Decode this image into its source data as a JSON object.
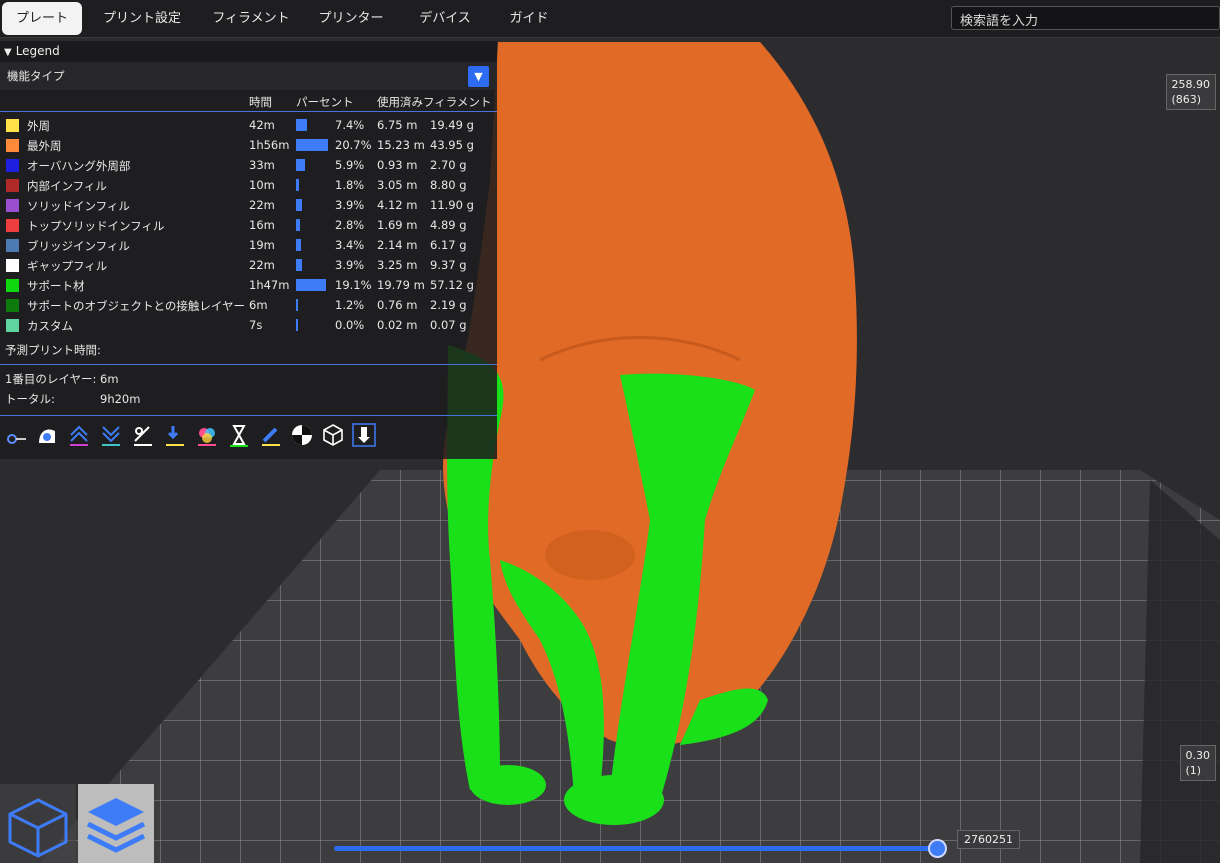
{
  "tabs": [
    {
      "label": "プレート"
    },
    {
      "label": "プリント設定"
    },
    {
      "label": "フィラメント"
    },
    {
      "label": "プリンター"
    },
    {
      "label": "デバイス"
    },
    {
      "label": "ガイド"
    }
  ],
  "search": {
    "placeholder": "検索語を入力"
  },
  "legend": {
    "title": "Legend",
    "feature_type_label": "機能タイプ",
    "columns": {
      "time": "時間",
      "percent": "パーセント",
      "filament": "使用済みフィラメント"
    },
    "rows": [
      {
        "color": "#ffe14a",
        "name": "外周",
        "time": "42m",
        "percent_value": 7.4,
        "percent": "7.4%",
        "length": "6.75 m",
        "weight": "19.49 g"
      },
      {
        "color": "#ff8a3a",
        "name": "最外周",
        "time": "1h56m",
        "percent_value": 20.7,
        "percent": "20.7%",
        "length": "15.23 m",
        "weight": "43.95 g"
      },
      {
        "color": "#1f1fe0",
        "name": "オーバハング外周部",
        "time": "33m",
        "percent_value": 5.9,
        "percent": "5.9%",
        "length": "0.93 m",
        "weight": "2.70 g"
      },
      {
        "color": "#b02a2a",
        "name": "内部インフィル",
        "time": "10m",
        "percent_value": 1.8,
        "percent": "1.8%",
        "length": "3.05 m",
        "weight": "8.80 g"
      },
      {
        "color": "#9a4fd0",
        "name": "ソリッドインフィル",
        "time": "22m",
        "percent_value": 3.9,
        "percent": "3.9%",
        "length": "4.12 m",
        "weight": "11.90 g"
      },
      {
        "color": "#ee3d3d",
        "name": "トップソリッドインフィル",
        "time": "16m",
        "percent_value": 2.8,
        "percent": "2.8%",
        "length": "1.69 m",
        "weight": "4.89 g"
      },
      {
        "color": "#4d7ab3",
        "name": "ブリッジインフィル",
        "time": "19m",
        "percent_value": 3.4,
        "percent": "3.4%",
        "length": "2.14 m",
        "weight": "6.17 g"
      },
      {
        "color": "#ffffff",
        "name": "ギャップフィル",
        "time": "22m",
        "percent_value": 3.9,
        "percent": "3.9%",
        "length": "3.25 m",
        "weight": "9.37 g"
      },
      {
        "color": "#10d810",
        "name": "サポート材",
        "time": "1h47m",
        "percent_value": 19.1,
        "percent": "19.1%",
        "length": "19.79 m",
        "weight": "57.12 g"
      },
      {
        "color": "#0c7a0c",
        "name": "サポートのオブジェクトとの接触レイヤー",
        "time": "6m",
        "percent_value": 1.2,
        "percent": "1.2%",
        "length": "0.76 m",
        "weight": "2.19 g"
      },
      {
        "color": "#5fd3a0",
        "name": "カスタム",
        "time": "7s",
        "percent_value": 0.0,
        "percent": "0.0%",
        "length": "0.02 m",
        "weight": "0.07 g"
      }
    ],
    "estimate_label": "予測プリント時間:",
    "first_layer_label": "1番目のレイヤー:",
    "first_layer_value": "6m",
    "total_label": "トータル:",
    "total_value": "9h20m",
    "icons": [
      "seam-icon",
      "retract-icon",
      "wipe-up-icon",
      "wipe-down-icon",
      "pressure-icon",
      "z-hop-icon",
      "color-change-icon",
      "pause-icon",
      "tool-icon",
      "checker-icon",
      "cube-wire-icon",
      "sequential-icon"
    ]
  },
  "slider": {
    "top_value": "258.90",
    "top_layer": "(863)",
    "bottom_value": "0.30",
    "bottom_layer": "(1)",
    "horizontal_value": "2760251"
  }
}
